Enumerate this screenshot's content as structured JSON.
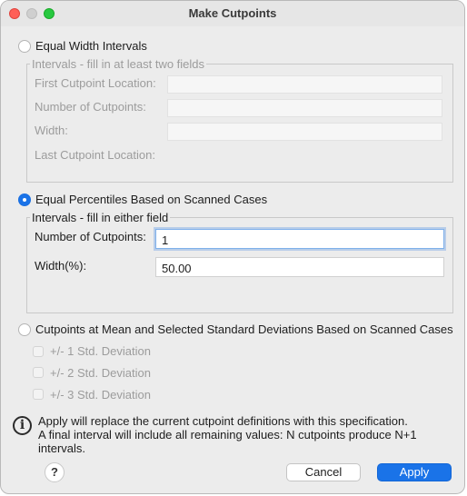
{
  "window": {
    "title": "Make Cutpoints"
  },
  "equal_width": {
    "label": "Equal Width Intervals",
    "selected": false,
    "group_title": "Intervals - fill in at least two fields",
    "first_cutpoint_label": "First Cutpoint Location:",
    "first_cutpoint_value": "",
    "num_cutpoints_label": "Number of Cutpoints:",
    "num_cutpoints_value": "",
    "width_label": "Width:",
    "width_value": "",
    "last_cutpoint_label": "Last Cutpoint Location:"
  },
  "equal_percentiles": {
    "label": "Equal Percentiles Based on Scanned Cases",
    "selected": true,
    "group_title": "Intervals - fill in either field",
    "num_cutpoints_label": "Number of Cutpoints:",
    "num_cutpoints_value": "1",
    "width_label": "Width(%):",
    "width_value": "50.00"
  },
  "mean_sd": {
    "label": "Cutpoints at Mean and Selected Standard Deviations Based on Scanned Cases",
    "selected": false,
    "options": [
      "+/- 1 Std. Deviation",
      "+/- 2 Std. Deviation",
      "+/- 3 Std. Deviation"
    ]
  },
  "info": {
    "icon": "info-icon",
    "line1": "Apply will replace the current cutpoint definitions with this specification.",
    "line2": "A final interval will include all remaining values: N cutpoints produce N+1",
    "line3": "intervals."
  },
  "buttons": {
    "help": "?",
    "cancel": "Cancel",
    "apply": "Apply"
  },
  "colors": {
    "accent": "#1a73e8",
    "close": "#ff5f57",
    "maximize": "#28c840"
  }
}
